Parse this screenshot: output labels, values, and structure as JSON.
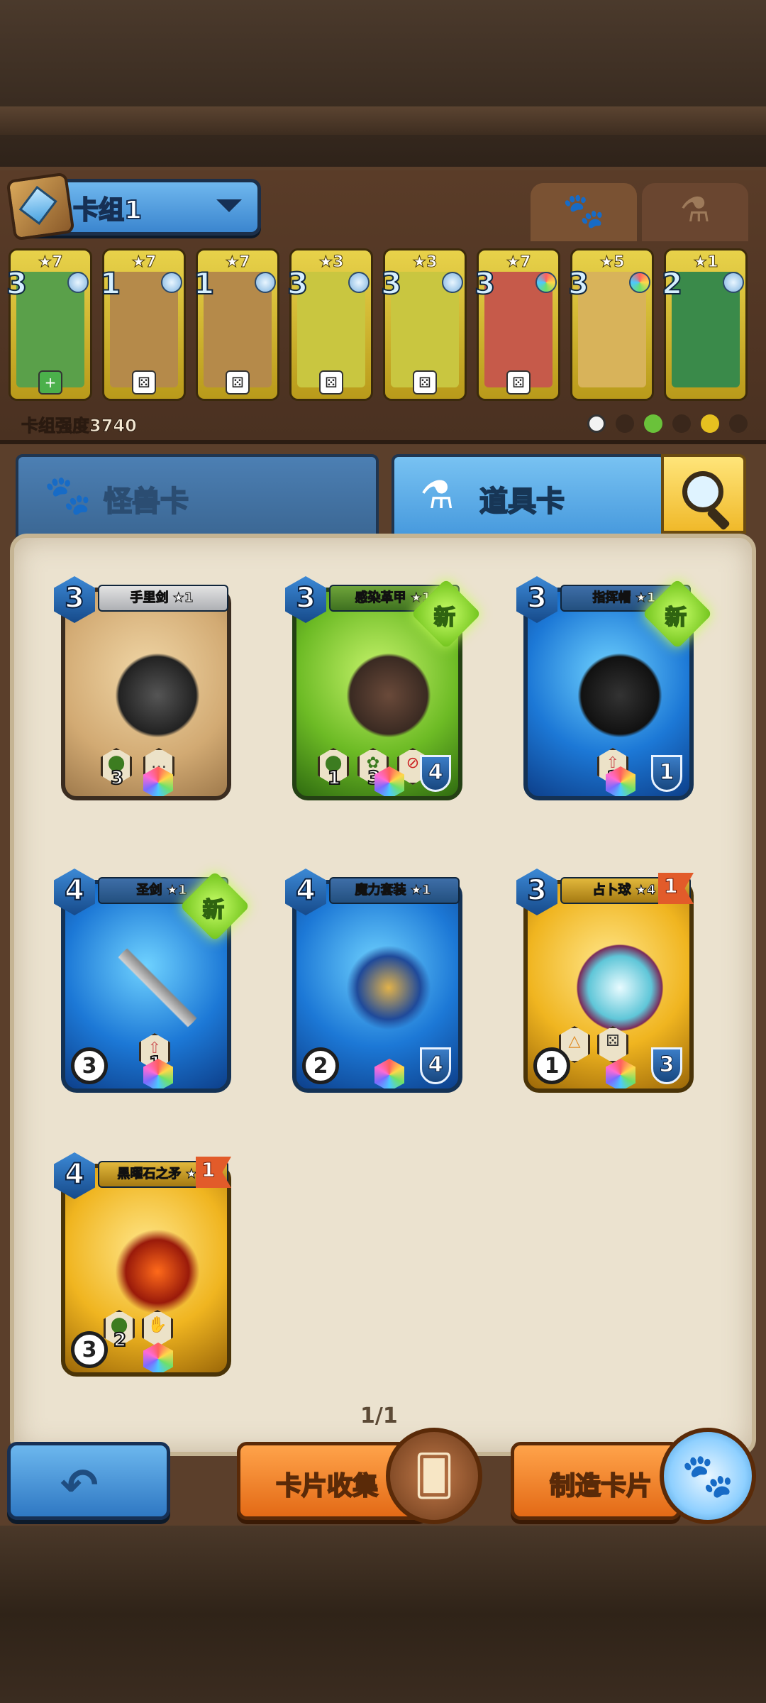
{
  "deck": {
    "title": "卡组1",
    "power_text": "卡组强度3740",
    "tabs": [
      "paw",
      "potion"
    ],
    "mini_cards": [
      {
        "stars": "★7",
        "cost": "3",
        "color": "#5aa04a"
      },
      {
        "stars": "★7",
        "cost": "1",
        "color": "#b58a4a"
      },
      {
        "stars": "★7",
        "cost": "1",
        "color": "#b58a4a"
      },
      {
        "stars": "★3",
        "cost": "3",
        "color": "#c9c640"
      },
      {
        "stars": "★3",
        "cost": "3",
        "color": "#c9c640"
      },
      {
        "stars": "★7",
        "cost": "3",
        "color": "#c65a4a"
      },
      {
        "stars": "★5",
        "cost": "3",
        "color": "#d8b35a"
      },
      {
        "stars": "★1",
        "cost": "2",
        "color": "#3a8a4a"
      }
    ]
  },
  "category_tabs": {
    "monster": "怪兽卡",
    "items": "道具卡"
  },
  "cards": [
    {
      "name": "手里剑 ★1",
      "cost": "3",
      "theme": "tan",
      "stats": [
        "3",
        "2"
      ]
    },
    {
      "name": "感染革甲 ★1",
      "cost": "3",
      "theme": "green",
      "badge": "新",
      "stats": [
        "1",
        "3"
      ],
      "shield": "4"
    },
    {
      "name": "指挥帽 ★1",
      "cost": "3",
      "theme": "blue",
      "badge": "新",
      "stats": [
        "2"
      ],
      "shield": "1"
    },
    {
      "name": "圣剑 ★1",
      "cost": "4",
      "theme": "blue",
      "badge": "新",
      "stats": [
        "1"
      ],
      "atk": "3"
    },
    {
      "name": "魔力套装 ★1",
      "cost": "4",
      "theme": "blue",
      "atk": "2",
      "shield": "4"
    },
    {
      "name": "占卜球 ★4",
      "cost": "3",
      "theme": "gold",
      "flag": "1",
      "atk": "1",
      "shield": "3"
    },
    {
      "name": "黑曜石之矛 ★2",
      "cost": "4",
      "theme": "gold",
      "flag": "1",
      "stats": [
        "2"
      ],
      "atk": "3"
    }
  ],
  "pager": "1/1",
  "bottom": {
    "back_icon": "back-arrow-icon",
    "collect_label": "卡片收集",
    "craft_label": "制造卡片"
  }
}
